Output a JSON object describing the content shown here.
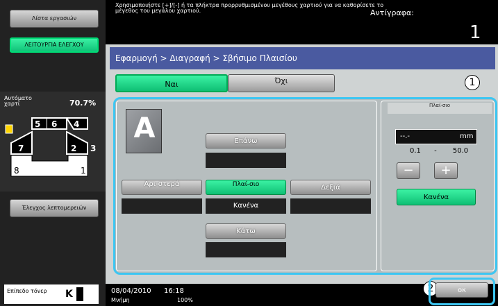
{
  "left_panel": {
    "list_jobs_label": "Λίστα εργασιών",
    "utility_label": "ΛΕΙΤΟΥΡΓΙΑ ΕΛΕΓΧΟΥ",
    "paper_label": "Αυτόματο χαρτί",
    "zoom": "70.7%",
    "detail_check_label": "Έλεγχος λεπτομερειών",
    "toner_label": "Επίπεδο τόνερ",
    "toner_color": "K",
    "tray_numbers": [
      "5",
      "6",
      "4",
      "7",
      "2",
      "3",
      "8",
      "1"
    ]
  },
  "header": {
    "message": "Χρησιμοποιήστε [+]/[-] ή τα πλήκτρα προρρυθμισμένου μεγέθους χαρτιού για να καθορίσετε το μέγεθος του μεγάλου χαρτιού.",
    "copies_label": "Αντίγραφα:",
    "copies_value": "1"
  },
  "breadcrumb": "Εφαρμογή > Διαγραφή > Σβήσιμο Πλαισίου",
  "tabs": {
    "yes": "Ναι",
    "no": "Όχι"
  },
  "sample_letter": "A",
  "frame_erase": {
    "top_label": "Επάνω",
    "left_label": "Αρι-στερά",
    "frame_label": "Πλαί-σιο",
    "frame_value": "Κανένα",
    "right_label": "Δεξιά",
    "bottom_label": "Κάτω"
  },
  "size_panel": {
    "title": "Πλαί-σιο",
    "value": "--.-",
    "unit": "mm",
    "min": "0.1",
    "dash": "-",
    "max": "50.0",
    "minus": "−",
    "plus": "+",
    "none_label": "Κανένα"
  },
  "callouts": {
    "one": "1",
    "two": "2"
  },
  "footer": {
    "date": "08/04/2010",
    "time": "16:18",
    "memory_label": "Μνήμη",
    "memory_value": "100%",
    "ok_label": "οκ"
  }
}
